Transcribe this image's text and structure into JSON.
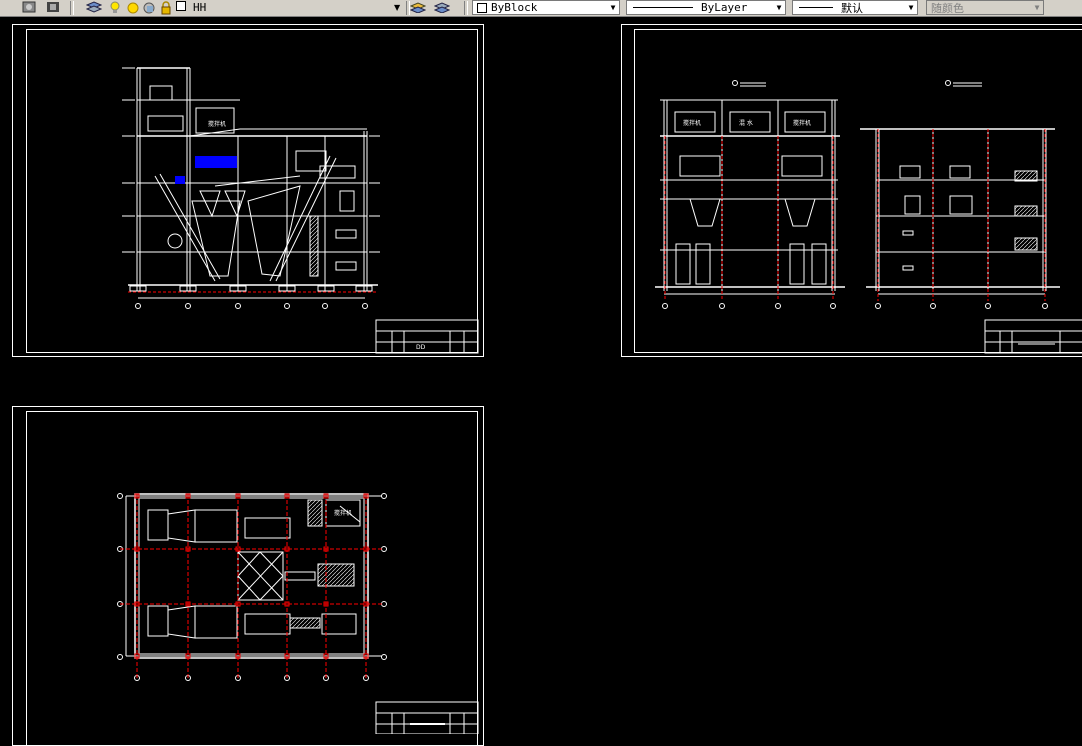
{
  "toolbar": {
    "layer_name": "HH",
    "color_value": "ByBlock",
    "linetype_value": "ByLayer",
    "lineweight_value": "默认",
    "plotstyle_value": "随颜色"
  },
  "drawings": {
    "elevation_sheet": {
      "room_label": "搅拌机",
      "title_block_text": "DD"
    },
    "sections_sheet": {
      "labels": [
        "搅拌机",
        "混 水",
        "搅拌机"
      ]
    },
    "plan_sheet": {
      "room_label": "搅拌机"
    }
  },
  "colors": {
    "background": "#000000",
    "lines": "#ffffff",
    "axis": "#ff0000",
    "highlight": "#0000ff",
    "toolbar": "#d4d0c8"
  }
}
